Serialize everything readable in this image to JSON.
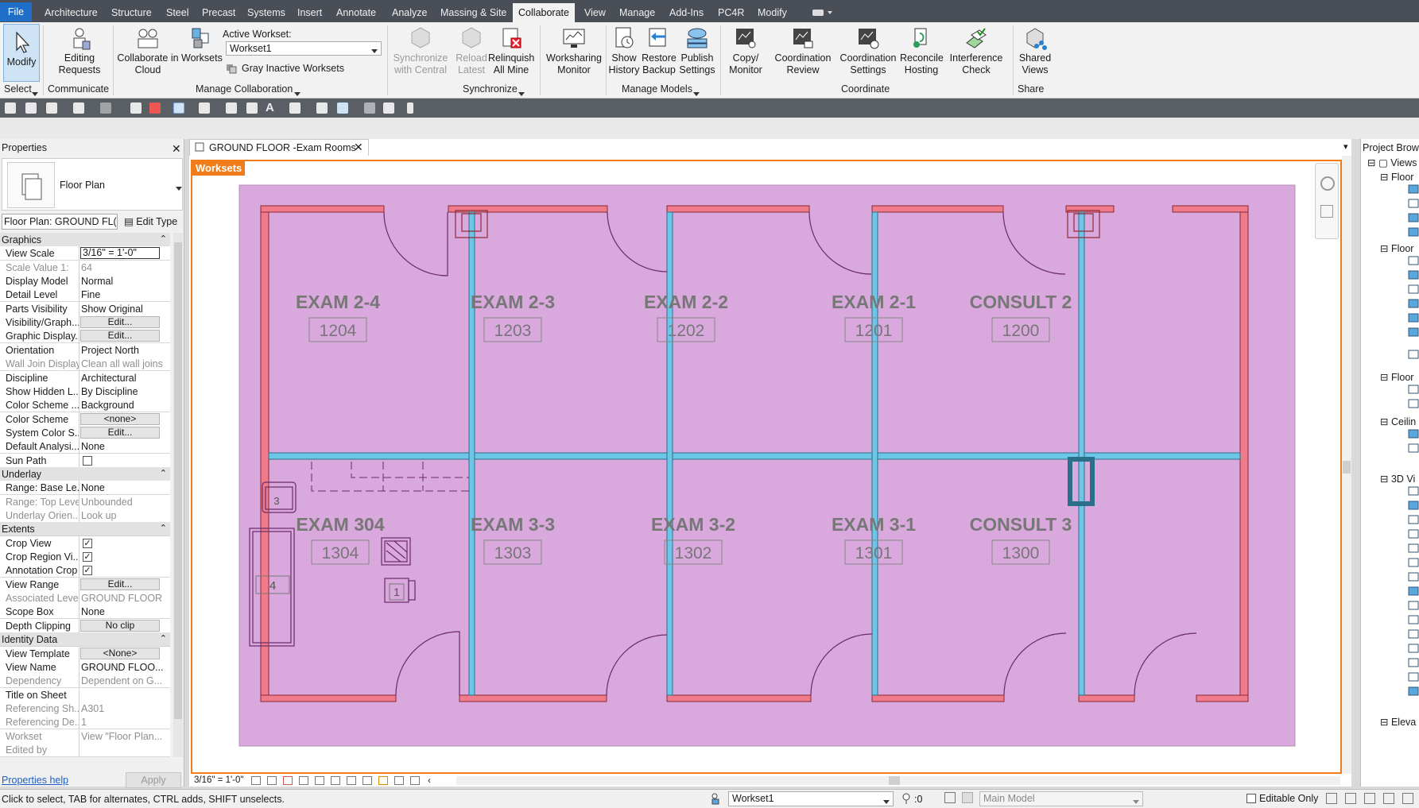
{
  "menu": {
    "tabs": [
      "File",
      "Architecture",
      "Structure",
      "Steel",
      "Precast",
      "Systems",
      "Insert",
      "Annotate",
      "Analyze",
      "Massing & Site",
      "Collaborate",
      "View",
      "Manage",
      "Add-Ins",
      "PC4R",
      "Modify"
    ],
    "active": "Collaborate"
  },
  "ribbon": {
    "modify": "Modify",
    "editing_requests": [
      "Editing",
      "Requests"
    ],
    "collab_cloud": [
      "Collaborate in",
      "Cloud"
    ],
    "worksets": "Worksets",
    "active_workset_label": "Active Workset:",
    "active_workset_value": "Workset1",
    "gray_inactive": "Gray Inactive Worksets",
    "sync_central": [
      "Synchronize",
      "with Central"
    ],
    "reload_latest": [
      "Reload",
      "Latest"
    ],
    "relinquish": [
      "Relinquish",
      "All Mine"
    ],
    "ws_monitor": [
      "Worksharing",
      "Monitor"
    ],
    "show_history": [
      "Show",
      "History"
    ],
    "restore_backup": [
      "Restore",
      "Backup"
    ],
    "publish_settings": [
      "Publish",
      "Settings"
    ],
    "copy_monitor": [
      "Copy/",
      "Monitor"
    ],
    "coord_review": [
      "Coordination",
      "Review"
    ],
    "coord_settings": [
      "Coordination",
      "Settings"
    ],
    "reconcile": [
      "Reconcile",
      "Hosting"
    ],
    "interference": [
      "Interference",
      "Check"
    ],
    "shared_views": [
      "Shared",
      "Views"
    ],
    "groups": {
      "select": "Select",
      "communicate": "Communicate",
      "manage_collab": "Manage Collaboration",
      "synchronize": "Synchronize",
      "manage_models": "Manage Models",
      "coordinate": "Coordinate",
      "share": "Share"
    }
  },
  "properties": {
    "title": "Properties",
    "type_name": "Floor Plan",
    "instance_selector": "Floor Plan: GROUND FL(",
    "edit_type": "Edit Type",
    "rows": [
      {
        "kind": "group",
        "label": "Graphics"
      },
      {
        "k": "View Scale",
        "v": "3/16\" = 1'-0\"",
        "style": "input"
      },
      {
        "k": "Scale Value    1:",
        "v": "64",
        "style": "grey"
      },
      {
        "k": "Display Model",
        "v": "Normal"
      },
      {
        "k": "Detail Level",
        "v": "Fine"
      },
      {
        "k": "Parts Visibility",
        "v": "Show Original"
      },
      {
        "k": "Visibility/Graph...",
        "v": "Edit...",
        "style": "button"
      },
      {
        "k": "Graphic Display...",
        "v": "Edit...",
        "style": "button"
      },
      {
        "k": "Orientation",
        "v": "Project North"
      },
      {
        "k": "Wall Join Display",
        "v": "Clean all wall joins",
        "style": "grey"
      },
      {
        "k": "Discipline",
        "v": "Architectural"
      },
      {
        "k": "Show Hidden L...",
        "v": "By Discipline"
      },
      {
        "k": "Color Scheme ...",
        "v": "Background"
      },
      {
        "k": "Color Scheme",
        "v": "<none>",
        "style": "button"
      },
      {
        "k": "System Color S...",
        "v": "Edit...",
        "style": "button"
      },
      {
        "k": "Default Analysi...",
        "v": "None"
      },
      {
        "k": "Sun Path",
        "v": "",
        "style": "check-off"
      },
      {
        "kind": "group",
        "label": "Underlay"
      },
      {
        "k": "Range: Base Le...",
        "v": "None"
      },
      {
        "k": "Range: Top Level",
        "v": "Unbounded",
        "style": "grey"
      },
      {
        "k": "Underlay Orien...",
        "v": "Look up",
        "style": "grey"
      },
      {
        "kind": "group",
        "label": "Extents"
      },
      {
        "k": "Crop View",
        "v": "",
        "style": "check-on"
      },
      {
        "k": "Crop Region Vi...",
        "v": "",
        "style": "check-on"
      },
      {
        "k": "Annotation Crop",
        "v": "",
        "style": "check-on"
      },
      {
        "k": "View Range",
        "v": "Edit...",
        "style": "button"
      },
      {
        "k": "Associated Level",
        "v": "GROUND FLOOR",
        "style": "grey"
      },
      {
        "k": "Scope Box",
        "v": "None"
      },
      {
        "k": "Depth Clipping",
        "v": "No clip",
        "style": "button"
      },
      {
        "kind": "group",
        "label": "Identity Data"
      },
      {
        "k": "View Template",
        "v": "<None>",
        "style": "button"
      },
      {
        "k": "View Name",
        "v": "GROUND FLOO..."
      },
      {
        "k": "Dependency",
        "v": "Dependent on G...",
        "style": "grey"
      },
      {
        "k": "Title on Sheet",
        "v": ""
      },
      {
        "k": "Referencing Sh...",
        "v": "A301",
        "style": "grey"
      },
      {
        "k": "Referencing De...",
        "v": "1",
        "style": "grey"
      },
      {
        "k": "Workset",
        "v": "View \"Floor Plan...",
        "style": "grey"
      },
      {
        "k": "Edited by",
        "v": "",
        "style": "grey"
      }
    ],
    "help": "Properties help",
    "apply": "Apply"
  },
  "view": {
    "tab_title": "GROUND FLOOR -Exam Rooms",
    "worksets_badge": "Worksets",
    "scale": "3/16\" = 1'-0\"",
    "rooms": [
      {
        "name": "EXAM 2-4",
        "num": "1204"
      },
      {
        "name": "EXAM 2-3",
        "num": "1203"
      },
      {
        "name": "EXAM 2-2",
        "num": "1202"
      },
      {
        "name": "EXAM 2-1",
        "num": "1201"
      },
      {
        "name": "CONSULT 2",
        "num": "1200"
      },
      {
        "name": "EXAM 304",
        "num": "1304"
      },
      {
        "name": "EXAM 3-3",
        "num": "1303"
      },
      {
        "name": "EXAM 3-2",
        "num": "1302"
      },
      {
        "name": "EXAM 3-1",
        "num": "1301"
      },
      {
        "name": "CONSULT 3",
        "num": "1300"
      }
    ],
    "tags": [
      "3",
      "4",
      "1"
    ]
  },
  "browser": {
    "title": "Project Brows",
    "items": [
      "Views",
      "Floor",
      "Floor",
      "Floor",
      "Ceilin",
      "3D Vi",
      "Eleva"
    ]
  },
  "status": {
    "hint": "Click to select, TAB for alternates, CTRL adds, SHIFT unselects.",
    "workset": "Workset1",
    "zero": ":0",
    "design_option": "Main Model",
    "editable_only": "Editable Only"
  },
  "colors": {
    "room_fill": "#d9a8dd",
    "exterior_wall": "#f07b8a",
    "interior_wall": "#6ec6e6",
    "crop_border": "#f07d1a",
    "menubar": "#4a4f57",
    "file_tab": "#1f6fc9"
  }
}
